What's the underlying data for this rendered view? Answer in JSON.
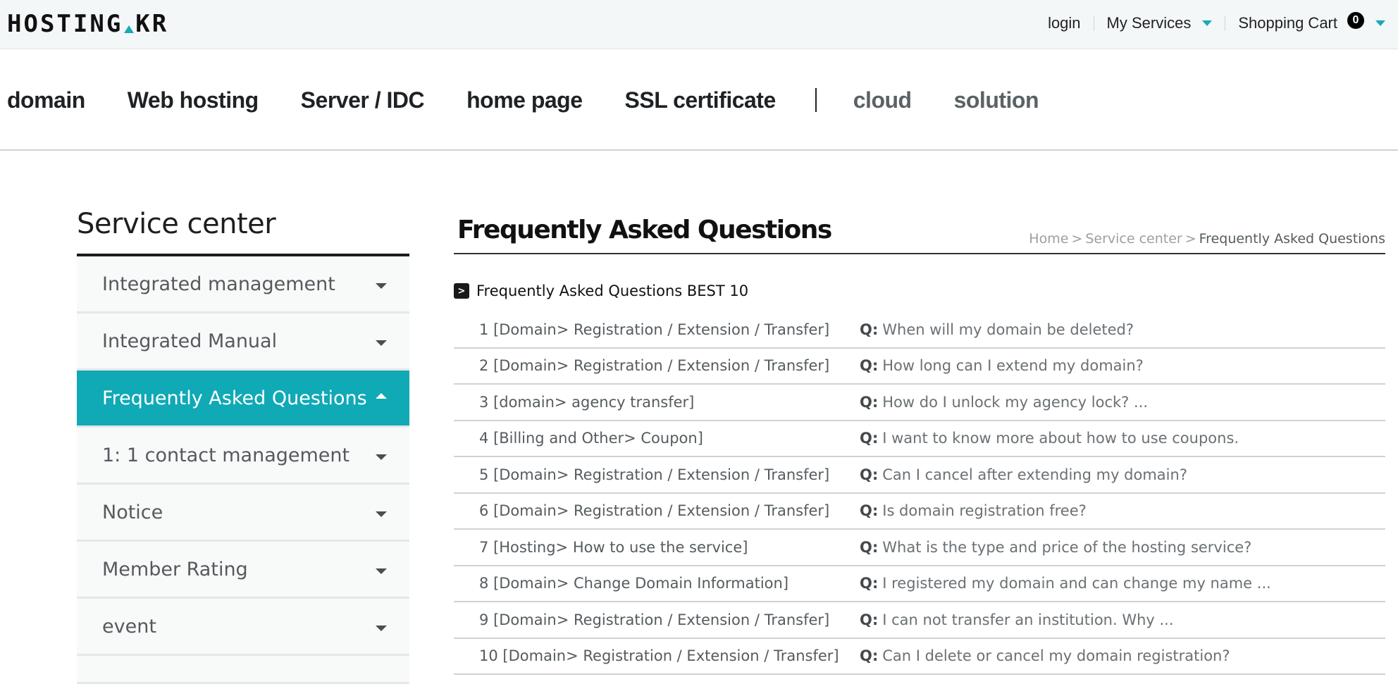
{
  "header": {
    "logo_left": "HOSTING",
    "logo_right": "KR",
    "util_links": {
      "login": "login",
      "my_services": "My Services",
      "shopping_cart": "Shopping Cart",
      "cart_count": "0"
    }
  },
  "main_nav": {
    "items": [
      "domain",
      "Web hosting",
      "Server / IDC",
      "home page",
      "SSL certificate"
    ],
    "secondary_items": [
      "cloud",
      "solution"
    ]
  },
  "sidebar": {
    "title": "Service center",
    "items": [
      {
        "label": "Integrated management",
        "active": false
      },
      {
        "label": "Integrated Manual",
        "active": false
      },
      {
        "label": "Frequently Asked Questions",
        "active": true
      },
      {
        "label": "1: 1 contact management",
        "active": false
      },
      {
        "label": "Notice",
        "active": false
      },
      {
        "label": "Member Rating",
        "active": false
      },
      {
        "label": "event",
        "active": false
      }
    ]
  },
  "content": {
    "title": "Frequently Asked Questions",
    "breadcrumb": [
      "Home",
      "Service center",
      "Frequently Asked Questions"
    ],
    "breadcrumb_separator": ">",
    "best_heading": "Frequently Asked Questions BEST 10",
    "q_prefix": "Q:",
    "faqs": [
      {
        "num": "1",
        "category": "[Domain> Registration / Extension / Transfer]",
        "question": "When will my domain be deleted?"
      },
      {
        "num": "2",
        "category": "[Domain> Registration / Extension / Transfer]",
        "question": "How long can I extend my domain?"
      },
      {
        "num": "3",
        "category": "[domain> agency transfer]",
        "question": "How do I unlock my agency lock? ..."
      },
      {
        "num": "4",
        "category": "[Billing and Other> Coupon]",
        "question": "I want to know more about how to use coupons."
      },
      {
        "num": "5",
        "category": "[Domain> Registration / Extension / Transfer]",
        "question": "Can I cancel after extending my domain?"
      },
      {
        "num": "6",
        "category": "[Domain> Registration / Extension / Transfer]",
        "question": "Is domain registration free?"
      },
      {
        "num": "7",
        "category": "[Hosting> How to use the service]",
        "question": "What is the type and price of the hosting service?"
      },
      {
        "num": "8",
        "category": "[Domain> Change Domain Information]",
        "question": "I registered my domain and can change my name ..."
      },
      {
        "num": "9",
        "category": "[Domain> Registration / Extension / Transfer]",
        "question": "I can not transfer an institution. Why ..."
      },
      {
        "num": "10",
        "category": "[Domain> Registration / Extension / Transfer]",
        "question": "Can I delete or cancel my domain registration?"
      }
    ]
  },
  "colors": {
    "accent": "#10a9b6",
    "topbar_bg": "#f3f7f8",
    "sidebar_item_bg": "#f8f9f9"
  }
}
